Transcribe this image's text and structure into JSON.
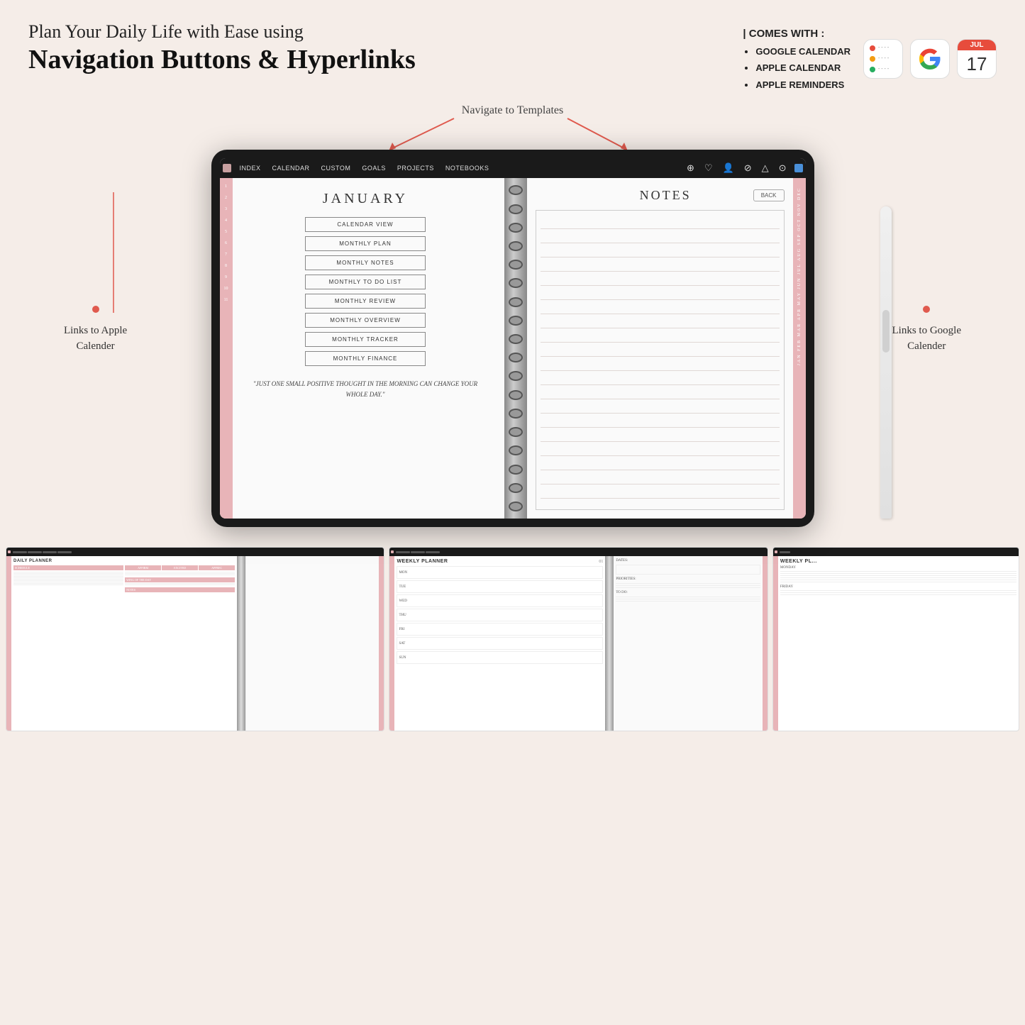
{
  "headline": {
    "pipe": "|",
    "sub": "Plan Your Daily Life with Ease using",
    "main": "Navigation Buttons & Hyperlinks"
  },
  "comes_with": {
    "title": "| COMES WITH :",
    "items": [
      "GOOGLE CALENDAR",
      "APPLE CALENDAR",
      "APPLE REMINDERS"
    ]
  },
  "app_icons": {
    "reminders_colors": [
      "#e74c3c",
      "#f39c12",
      "#27ae60"
    ],
    "google_letter": "G",
    "calendar_month": "JUL",
    "calendar_day": "17"
  },
  "navigate_label": "Navigate to Templates",
  "annotations": {
    "left": "Links to Apple\nCalender",
    "right": "Links to Google\nCalender"
  },
  "nav_items": [
    "INDEX",
    "CALENDAR",
    "CUSTOM",
    "GOALS",
    "PROJECTS",
    "NOTEBOOKS"
  ],
  "month": "JANUARY",
  "nav_buttons": [
    "CALENDAR VIEW",
    "MONTHLY PLAN",
    "MONTHLY NOTES",
    "MONTHLY TO DO LIST",
    "MONTHLY REVIEW",
    "MONTHLY OVERVIEW",
    "MONTHLY TRACKER",
    "MONTHLY FINANCE"
  ],
  "quote": "\"Just one small positive thought in\nthe morning can change your\nwhole day.\"",
  "notes_title": "NOTES",
  "back_label": "BACK",
  "thumbnails": [
    {
      "title": "DAILY PLANNER",
      "type": "daily"
    },
    {
      "title": "WEEKLY PLANNER",
      "type": "weekly",
      "number": "01"
    },
    {
      "title": "WEEKLY PL...",
      "type": "weekly2"
    }
  ],
  "weekly_days": [
    "MON",
    "TUE",
    "WED",
    "THU",
    "FRI",
    "SAT",
    "SUN"
  ],
  "weekly_right": [
    "DATES:",
    "PRIORITIES:",
    "TO DO:"
  ]
}
